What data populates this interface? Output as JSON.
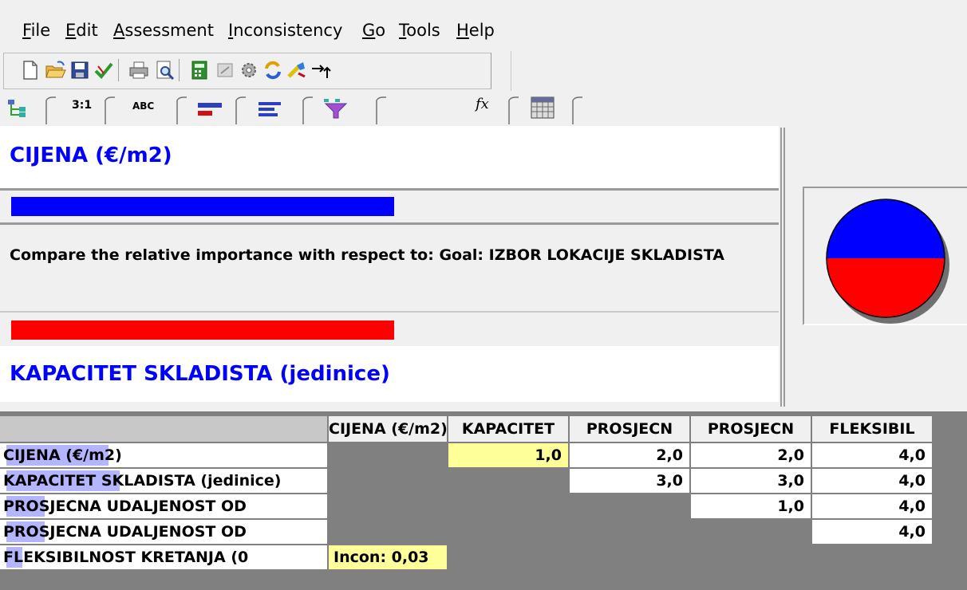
{
  "menu": {
    "items": [
      {
        "label": "File"
      },
      {
        "label": "Edit"
      },
      {
        "label": "Assessment"
      },
      {
        "label": "Inconsistency"
      },
      {
        "label": "Go"
      },
      {
        "label": "Tools"
      },
      {
        "label": "Help"
      }
    ]
  },
  "toolbar": {
    "icons": [
      "new-document-icon",
      "open-folder-icon",
      "save-icon",
      "checkmark-icon",
      "print-icon",
      "print-preview-icon",
      "calculator-icon",
      "inconsistency-icon",
      "gear-icon",
      "refresh-icon",
      "tools-icon",
      "arrow-up-icon"
    ]
  },
  "tabs": [
    {
      "label": "",
      "icon": "tree-icon"
    },
    {
      "label": "3:1",
      "icon": ""
    },
    {
      "label": "ABC",
      "icon": ""
    },
    {
      "label": "",
      "icon": "graphical-bars-icon"
    },
    {
      "label": "",
      "icon": "verbal-bars-icon"
    },
    {
      "label": "",
      "icon": "funnel-icon"
    },
    {
      "label": "fx",
      "icon": ""
    },
    {
      "label": "",
      "icon": "matrix-icon"
    }
  ],
  "comparison": {
    "top_element": "CIJENA (€/m2)",
    "question": "Compare the relative importance with respect to: Goal: IZBOR LOKACIJE SKLADISTA",
    "bottom_element": "KAPACITET SKLADISTA (jedinice)",
    "top_color": "#0000ff",
    "bottom_color": "#ff0000"
  },
  "pie": {
    "top_fraction": 0.5,
    "top_color": "#0000ff",
    "bottom_color": "#ff0000"
  },
  "matrix": {
    "columns": [
      "CIJENA (€/m2)",
      "KAPACITET",
      "PROSJECN",
      "PROSJECN",
      "FLEKSIBIL"
    ],
    "rows": [
      {
        "label": "CIJENA (€/m2)",
        "values": [
          "",
          "1,0",
          "2,0",
          "2,0",
          "4,0"
        ]
      },
      {
        "label": "KAPACITET SKLADISTA (jedinice)",
        "values": [
          "",
          "",
          "3,0",
          "3,0",
          "4,0"
        ]
      },
      {
        "label": "PROSJECNA UDALJENOST OD",
        "values": [
          "",
          "",
          "",
          "1,0",
          "4,0"
        ]
      },
      {
        "label": "PROSJECNA UDALJENOST OD",
        "values": [
          "",
          "",
          "",
          "",
          "4,0"
        ]
      },
      {
        "label": "FLEKSIBILNOST KRETANJA (0",
        "values": [
          "Incon: 0,03",
          "",
          "",
          "",
          ""
        ]
      }
    ],
    "highlight_color": "#ffff99"
  }
}
